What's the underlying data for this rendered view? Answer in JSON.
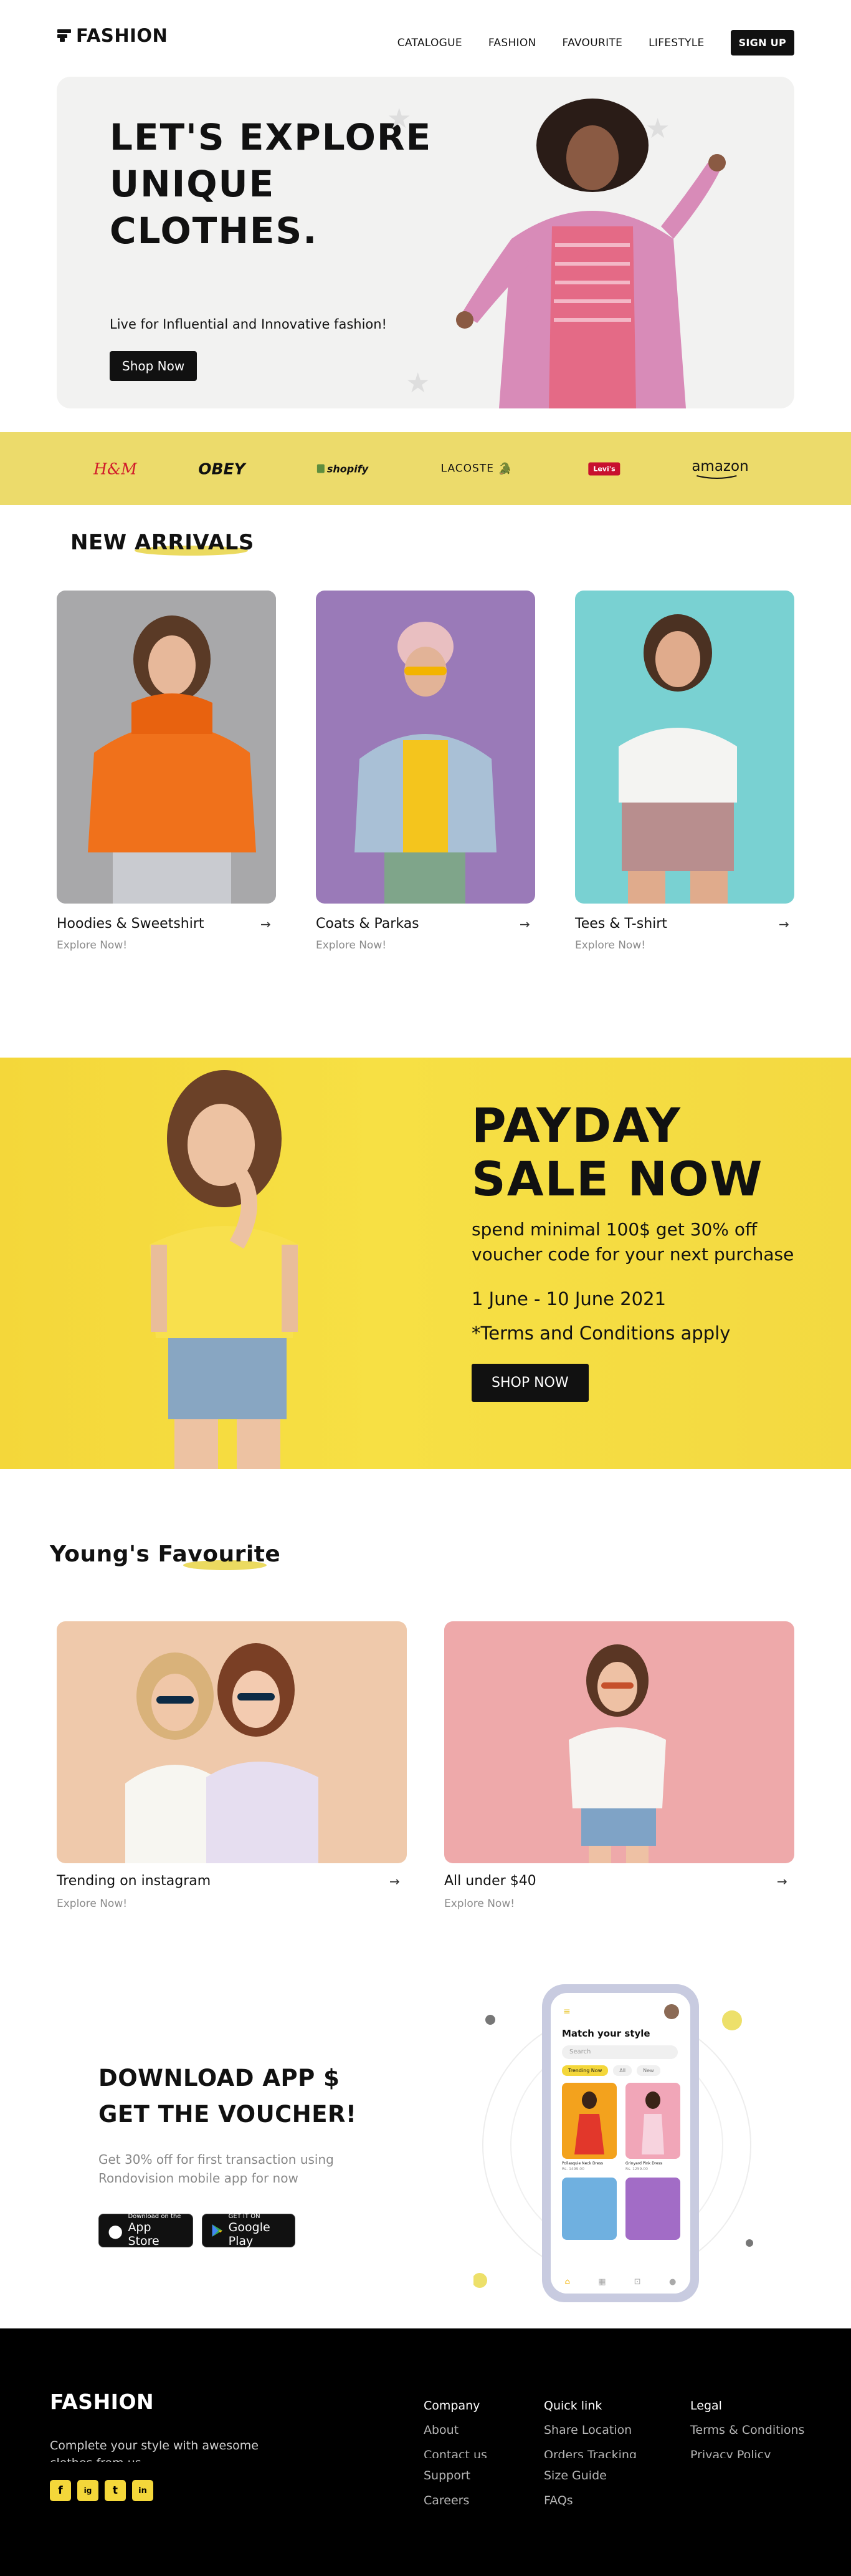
{
  "nav": {
    "logo": "FASHION",
    "links": [
      "CATALOGUE",
      "FASHION",
      "FAVOURITE",
      "LIFESTYLE"
    ],
    "signup": "SIGN UP"
  },
  "hero": {
    "title": "LET'S EXPLORE UNIQUE CLOTHES.",
    "subtitle": "Live for Influential and Innovative fashion!",
    "button": "Shop Now"
  },
  "brands": [
    "H&M",
    "OBEY",
    "shopify",
    "LACOSTE",
    "Levi's",
    "amazon"
  ],
  "new_arrivals": {
    "title": "NEW ARRIVALS",
    "items": [
      {
        "title": "Hoodies & Sweetshirt",
        "sub": "Explore Now!"
      },
      {
        "title": "Coats & Parkas",
        "sub": "Explore Now!"
      },
      {
        "title": "Tees & T-shirt",
        "sub": "Explore Now!"
      }
    ]
  },
  "payday": {
    "title_line1": "PAYDAY",
    "title_line2": "SALE NOW",
    "text": "spend minimal 100$ get 30% off voucher code for your next purchase",
    "date": "1 June - 10 June 2021",
    "terms": "*Terms and Conditions apply",
    "button": "SHOP NOW"
  },
  "young_favourite": {
    "title": "Young's Favourite",
    "items": [
      {
        "title": "Trending on instagram",
        "sub": "Explore Now!"
      },
      {
        "title": "All under $40",
        "sub": "Explore Now!"
      }
    ]
  },
  "app": {
    "title_line1": "DOWNLOAD APP $",
    "title_line2": "GET THE VOUCHER!",
    "desc": "Get 30% off for first transaction using Rondovision mobile app for now",
    "appstore_small": "Download on the",
    "appstore_big": "App Store",
    "google_small": "GET IT ON",
    "google_big": "Google Play",
    "phone": {
      "heading": "Match your style",
      "search": "Search",
      "chips": [
        "Trending Now",
        "All",
        "New"
      ],
      "products": [
        {
          "name": "Pollasquie Neck Dress",
          "price": "Rs. 1499.00"
        },
        {
          "name": "Grinyard Pink Dress",
          "price": "Rs. 1259.00"
        }
      ]
    }
  },
  "footer": {
    "logo": "FASHION",
    "text": "Complete your style with awesome clothes from us.",
    "social": [
      "f",
      "ig",
      "t",
      "in"
    ],
    "columns": [
      {
        "title": "Company",
        "links": [
          "About",
          "Contact us",
          "Support",
          "Careers"
        ]
      },
      {
        "title": "Quick link",
        "links": [
          "Share Location",
          "Orders Tracking",
          "Size Guide",
          "FAQs"
        ]
      },
      {
        "title": "Legal",
        "links": [
          "Terms & Conditions",
          "Privacy Policy"
        ]
      }
    ]
  },
  "colors": {
    "accent": "#f4d73a",
    "brand_strip": "#ecdb6b",
    "dark": "#111111"
  }
}
